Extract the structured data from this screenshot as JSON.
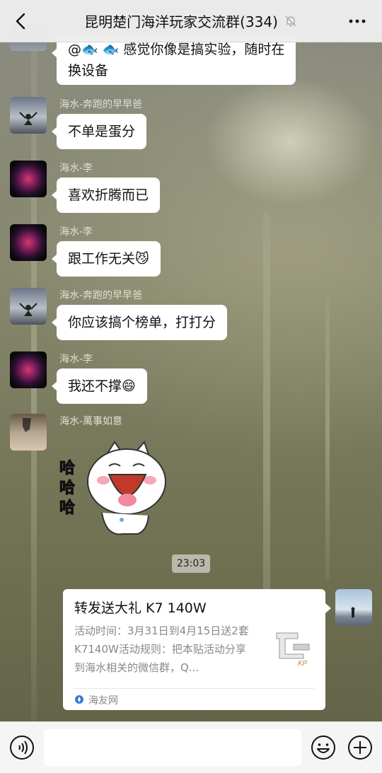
{
  "header": {
    "title": "昆明楚门海洋玩家交流群(334)"
  },
  "messages": [
    {
      "sender": "",
      "text": "@🐟 🐟 感觉你像是搞实验，随时在",
      "text2": "换设备"
    },
    {
      "sender": "海水-奔跑的早早爸",
      "text": "不单是蛋分"
    },
    {
      "sender": "海水-李",
      "text": "喜欢折腾而已"
    },
    {
      "sender": "海水-李",
      "text": "跟工作无关😼"
    },
    {
      "sender": "海水-奔跑的早早爸",
      "text": "你应该搞个榜单，打打分"
    },
    {
      "sender": "海水-李",
      "text": "我还不撑😄"
    },
    {
      "sender": "海水-萬事如意",
      "sticker_text": [
        "哈",
        "哈",
        "哈"
      ]
    }
  ],
  "timestamp": "23:03",
  "card": {
    "title": "转发送大礼 K7 140W",
    "description": "活动时间：3月31日到4月15日送2套K7140W活动规则：把本贴活动分享到海水相关的微信群，Q...",
    "source": "海友网",
    "thumb_label": "KP"
  },
  "colors": {
    "header_bg": "#ededed",
    "bubble_bg": "#ffffff",
    "footer_bg": "#f5f5f5"
  },
  "icons": {
    "back": "chevron-left-icon",
    "mute": "bell-off-icon",
    "more": "more-icon",
    "voice": "voice-icon",
    "emoji": "emoji-icon",
    "plus": "plus-icon"
  }
}
